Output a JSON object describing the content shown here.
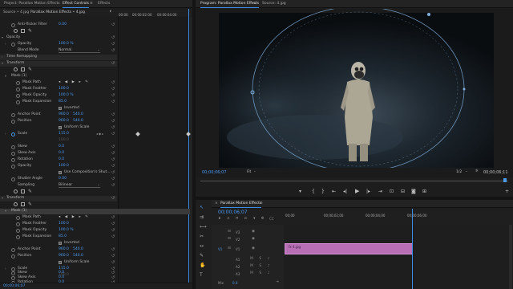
{
  "top_left_tabs": {
    "project": "Project: Parallax Motion Effects",
    "effect_controls": "Effect Controls",
    "effects": "Effects",
    "menu": "≡"
  },
  "ec_header": {
    "source": "Source • 4.jpg",
    "sequence": "Parallax Motion Effects • 4.jpg",
    "ruler": [
      "00:00",
      "00:00:02:00",
      "00:00:04:00"
    ]
  },
  "ec_rows": {
    "anti_flicker": {
      "label": "Anti-flicker Filter",
      "value": "0.00"
    },
    "opacity_hdr": {
      "label": "Opacity"
    },
    "opacity": {
      "label": "Opacity",
      "value": "100.0 %"
    },
    "blend_mode": {
      "label": "Blend Mode",
      "value": "Normal"
    },
    "time_remap": {
      "label": "Time Remapping"
    },
    "transform1": {
      "label": "Transform"
    },
    "mask1": {
      "label": "Mask (1)"
    },
    "mask_path": {
      "label": "Mask Path"
    },
    "mask_feather": {
      "label": "Mask Feather",
      "value": "100.0"
    },
    "mask_opacity": {
      "label": "Mask Opacity",
      "value": "100.0 %"
    },
    "mask_expansion": {
      "label": "Mask Expansion",
      "value": "85.0"
    },
    "inverted": {
      "label": "Inverted"
    },
    "anchor_point": {
      "label": "Anchor Point",
      "value": "960.0",
      "value2": "540.0"
    },
    "position": {
      "label": "Position",
      "value": "960.0",
      "value2": "540.0"
    },
    "uniform_scale": {
      "label": "Uniform Scale"
    },
    "scale": {
      "label": "Scale",
      "value": "115.0"
    },
    "scale_w": {
      "value": "100.0"
    },
    "skew": {
      "label": "Skew",
      "value": "0.0"
    },
    "skew_axis": {
      "label": "Skew Axis",
      "value": "0.0"
    },
    "rotation": {
      "label": "Rotation",
      "value": "0.0"
    },
    "opacity2": {
      "label": "Opacity",
      "value": "100.0"
    },
    "use_comp": {
      "label": "Use Composition's Shut..."
    },
    "shutter_angle": {
      "label": "Shutter Angle",
      "value": "0.00"
    },
    "sampling": {
      "label": "Sampling",
      "value": "Bilinear"
    },
    "transform2": {
      "label": "Transform"
    },
    "mask2": {
      "label": "Mask (1)"
    },
    "mask_path2": {
      "label": "Mask Path"
    },
    "mask_feather2": {
      "label": "Mask Feather",
      "value": "100.0"
    },
    "mask_opacity2": {
      "label": "Mask Opacity",
      "value": "100.0 %"
    },
    "mask_expansion2": {
      "label": "Mask Expansion",
      "value": "85.0"
    },
    "inverted2": {
      "label": "Inverted"
    },
    "anchor_point2": {
      "label": "Anchor Point",
      "value": "960.0",
      "value2": "540.0"
    },
    "position2": {
      "label": "Position",
      "value": "960.0",
      "value2": "540.0"
    },
    "uniform_scale2": {
      "label": "Uniform Scale"
    },
    "scale2": {
      "label": "Scale",
      "value": "115.0"
    },
    "scale_w2": {
      "value": "100.0"
    },
    "skew2": {
      "label": "Skew",
      "value": "0.0"
    },
    "skew_axis2": {
      "label": "Skew Axis",
      "value": "0.0"
    },
    "rotation2": {
      "label": "Rotation",
      "value": "0.0"
    }
  },
  "ec_footer": {
    "timecode": "00;00;06;07"
  },
  "program_tabs": {
    "program": "Program: Parallax Motion Effects",
    "menu": "≡",
    "source": "Source: 4.jpg"
  },
  "program": {
    "timecode": "00;00;06;07",
    "fit": "Fit",
    "quality": "1/2",
    "duration": "00;00;06;11"
  },
  "timeline": {
    "tab": "Parallax Motion Effects",
    "menu": "≡",
    "timecode": "00;00;06;07",
    "ruler": [
      "00;00",
      "00;00;02;00",
      "00;00;04;00",
      "00;00;06;00"
    ],
    "tracks": [
      {
        "name": "V3",
        "left": "V1"
      },
      {
        "name": "V2",
        "left": "V1"
      },
      {
        "name": "V1",
        "left": "V1"
      },
      {
        "name": "A1",
        "left": "A1"
      },
      {
        "name": "A2",
        "left": "A1"
      },
      {
        "name": "A3",
        "left": "A1"
      }
    ],
    "clip_label": "fx 4.jpg",
    "mix_label": "Mix",
    "mix_value": "0.0"
  }
}
